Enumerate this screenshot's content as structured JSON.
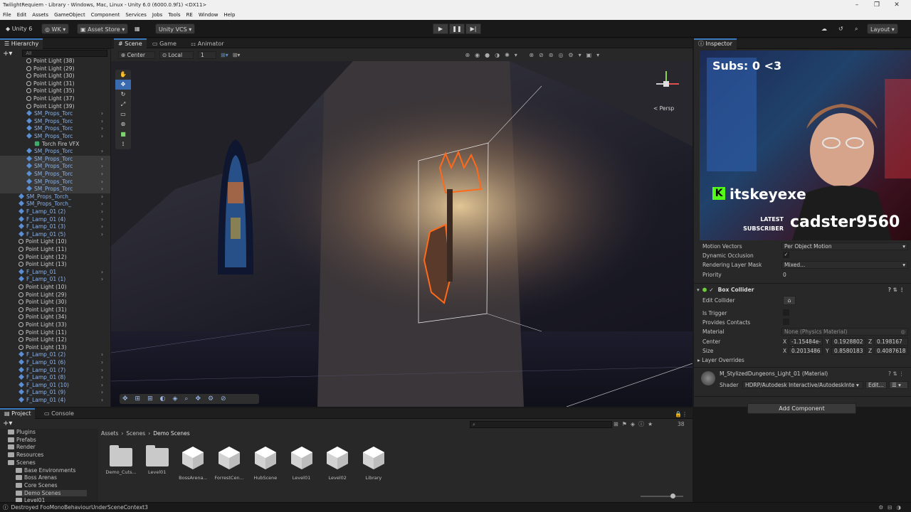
{
  "window": {
    "title": "TwilightRequiem - Library - Windows, Mac, Linux - Unity 6.0 (6000.0.9f1) <DX11>"
  },
  "menu": [
    "File",
    "Edit",
    "Assets",
    "GameObject",
    "Component",
    "Services",
    "Jobs",
    "Tools",
    "RE",
    "Window",
    "Help"
  ],
  "toolbar": {
    "unity": "Unity 6",
    "account": "WK",
    "asset_store": "Asset Store",
    "vcs": "Unity VCS",
    "layout": "Layout"
  },
  "hierarchy": {
    "tab": "Hierarchy",
    "search_placeholder": "All",
    "items": [
      {
        "label": "Point Light (38)",
        "indent": 3,
        "type": "light"
      },
      {
        "label": "Point Light (29)",
        "indent": 3,
        "type": "light"
      },
      {
        "label": "Point Light (30)",
        "indent": 3,
        "type": "light"
      },
      {
        "label": "Point Light (31)",
        "indent": 3,
        "type": "light"
      },
      {
        "label": "Point Light (35)",
        "indent": 3,
        "type": "light"
      },
      {
        "label": "Point Light (37)",
        "indent": 3,
        "type": "light"
      },
      {
        "label": "Point Light (39)",
        "indent": 3,
        "type": "light"
      },
      {
        "label": "SM_Props_Torc",
        "indent": 3,
        "type": "prefab"
      },
      {
        "label": "SM_Props_Torc",
        "indent": 3,
        "type": "prefab"
      },
      {
        "label": "SM_Props_Torc",
        "indent": 3,
        "type": "prefab"
      },
      {
        "label": "SM_Props_Torc",
        "indent": 3,
        "type": "prefab"
      },
      {
        "label": "Torch Fire VFX",
        "indent": 4,
        "type": "vfx"
      },
      {
        "label": "SM_Props_Torc",
        "indent": 3,
        "type": "prefab"
      },
      {
        "label": "SM_Props_Torc",
        "indent": 3,
        "type": "prefab"
      },
      {
        "label": "SM_Props_Torc",
        "indent": 3,
        "type": "prefab"
      },
      {
        "label": "SM_Props_Torc",
        "indent": 3,
        "type": "prefab"
      },
      {
        "label": "SM_Props_Torc",
        "indent": 3,
        "type": "prefab"
      },
      {
        "label": "SM_Props_Torc",
        "indent": 3,
        "type": "prefab"
      },
      {
        "label": "SM_Props_Torch_",
        "indent": 2,
        "type": "prefab"
      },
      {
        "label": "SM_Props_Torch_",
        "indent": 2,
        "type": "prefab"
      },
      {
        "label": "F_Lamp_01 (2)",
        "indent": 2,
        "type": "prefab"
      },
      {
        "label": "F_Lamp_01 (4)",
        "indent": 2,
        "type": "prefab"
      },
      {
        "label": "F_Lamp_01 (3)",
        "indent": 2,
        "type": "prefab"
      },
      {
        "label": "F_Lamp_01 (5)",
        "indent": 2,
        "type": "prefab"
      },
      {
        "label": "Point Light (10)",
        "indent": 2,
        "type": "light"
      },
      {
        "label": "Point Light (11)",
        "indent": 2,
        "type": "light"
      },
      {
        "label": "Point Light (12)",
        "indent": 2,
        "type": "light"
      },
      {
        "label": "Point Light (13)",
        "indent": 2,
        "type": "light"
      },
      {
        "label": "F_Lamp_01",
        "indent": 2,
        "type": "prefab"
      },
      {
        "label": "F_Lamp_01 (1)",
        "indent": 2,
        "type": "prefab"
      },
      {
        "label": "Point Light (10)",
        "indent": 2,
        "type": "light"
      },
      {
        "label": "Point Light (29)",
        "indent": 2,
        "type": "light"
      },
      {
        "label": "Point Light (30)",
        "indent": 2,
        "type": "light"
      },
      {
        "label": "Point Light (31)",
        "indent": 2,
        "type": "light"
      },
      {
        "label": "Point Light (34)",
        "indent": 2,
        "type": "light"
      },
      {
        "label": "Point Light (33)",
        "indent": 2,
        "type": "light"
      },
      {
        "label": "Point Light (11)",
        "indent": 2,
        "type": "light"
      },
      {
        "label": "Point Light (12)",
        "indent": 2,
        "type": "light"
      },
      {
        "label": "Point Light (13)",
        "indent": 2,
        "type": "light"
      },
      {
        "label": "F_Lamp_01 (2)",
        "indent": 2,
        "type": "prefab"
      },
      {
        "label": "F_Lamp_01 (6)",
        "indent": 2,
        "type": "prefab"
      },
      {
        "label": "F_Lamp_01 (7)",
        "indent": 2,
        "type": "prefab"
      },
      {
        "label": "F_Lamp_01 (8)",
        "indent": 2,
        "type": "prefab"
      },
      {
        "label": "F_Lamp_01 (10)",
        "indent": 2,
        "type": "prefab"
      },
      {
        "label": "F_Lamp_01 (9)",
        "indent": 2,
        "type": "prefab"
      },
      {
        "label": "F_Lamp_01 (4)",
        "indent": 2,
        "type": "prefab"
      }
    ]
  },
  "scene": {
    "tabs": [
      "Scene",
      "Game",
      "Animator"
    ],
    "pivot": "Center",
    "space": "Local",
    "snap": "1",
    "view": "< Persp"
  },
  "overlay": {
    "subs": "Subs: 0 <3",
    "channel": "itskeyexe",
    "latest": "LATEST",
    "subscriber": "SUBSCRIBER",
    "sub_name": "cadster9560"
  },
  "inspector": {
    "tab": "Inspector",
    "rows": [
      {
        "label": "Motion Vectors",
        "value": "Per Object Motion",
        "kind": "dropdown"
      },
      {
        "label": "Dynamic Occlusion",
        "value": "✓",
        "kind": "check"
      },
      {
        "label": "Rendering Layer Mask",
        "value": "Mixed...",
        "kind": "dropdown"
      },
      {
        "label": "Priority",
        "value": "0",
        "kind": "text"
      }
    ],
    "box_collider": {
      "title": "Box Collider",
      "edit": "Edit Collider",
      "is_trigger": "Is Trigger",
      "provides": "Provides Contacts",
      "material_label": "Material",
      "material": "None (Physics Material)",
      "center_label": "Center",
      "size_label": "Size",
      "cx": "-1.15484e-(",
      "cy": "0.1928802",
      "cz": "0.198167",
      "sx": "0.2013486",
      "sy": "0.8580183",
      "sz": "0.4087618",
      "layer": "Layer Overrides"
    },
    "material": {
      "name": "M_StylizedDungeons_Light_01 (Material)",
      "shader_label": "Shader",
      "shader": "HDRP/Autodesk Interactive/AutodeskInte",
      "edit": "Edit..."
    },
    "add_component": "Add Component"
  },
  "project": {
    "tabs": [
      "Project",
      "Console"
    ],
    "tree": [
      {
        "label": "Plugins",
        "indent": 1
      },
      {
        "label": "Prefabs",
        "indent": 1
      },
      {
        "label": "Render",
        "indent": 1
      },
      {
        "label": "Resources",
        "indent": 1
      },
      {
        "label": "Scenes",
        "indent": 1
      },
      {
        "label": "Base Environments",
        "indent": 2
      },
      {
        "label": "Boss Arenas",
        "indent": 2
      },
      {
        "label": "Core Scenes",
        "indent": 2
      },
      {
        "label": "Demo Scenes",
        "indent": 2
      },
      {
        "label": "Level01",
        "indent": 2
      }
    ],
    "breadcrumb": [
      "Assets",
      "Scenes",
      "Demo Scenes"
    ],
    "count": "38",
    "assets": [
      {
        "label": "Demo_Cuts...",
        "kind": "folder"
      },
      {
        "label": "Level01",
        "kind": "folder"
      },
      {
        "label": "BossArena...",
        "kind": "scene"
      },
      {
        "label": "ForrestCen...",
        "kind": "scene"
      },
      {
        "label": "HubScene",
        "kind": "scene"
      },
      {
        "label": "Level01",
        "kind": "scene"
      },
      {
        "label": "Level02",
        "kind": "scene"
      },
      {
        "label": "Library",
        "kind": "scene"
      }
    ]
  },
  "status": "Destroyed FooMonoBehaviourUnderSceneContext3"
}
